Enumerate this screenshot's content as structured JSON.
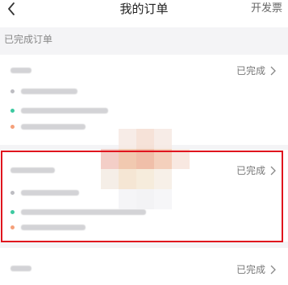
{
  "header": {
    "title": "我的订单",
    "invoice_label": "开发票",
    "back_icon": "chevron-left-icon"
  },
  "section": {
    "label": "已完成订单"
  },
  "orders": [
    {
      "status": "已完成",
      "status_icon": "chevron-right-icon"
    },
    {
      "status": "已完成",
      "status_icon": "chevron-right-icon"
    },
    {
      "status": "已完成",
      "status_icon": "chevron-right-icon"
    }
  ],
  "colors": {
    "highlight": "#e0141e",
    "dot_green": "#3cc9a0",
    "dot_orange": "#f5a07a"
  }
}
